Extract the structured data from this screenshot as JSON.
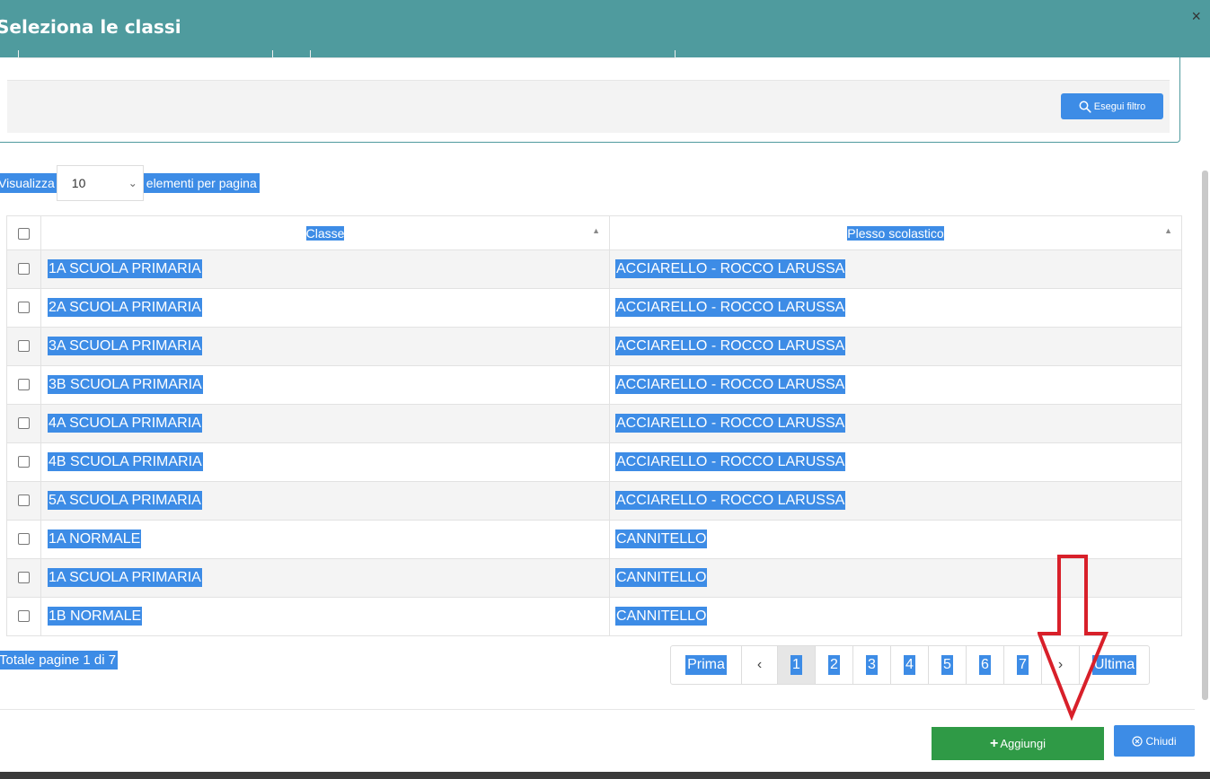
{
  "dialog": {
    "title": "Seleziona le classi",
    "close_glyph": "×"
  },
  "filter": {
    "button_label": "Esegui filtro",
    "button_icon": "search-icon"
  },
  "page_size": {
    "label_before": "Visualizza",
    "value": "10",
    "label_after": "elementi per pagina"
  },
  "table": {
    "headers": {
      "classe": "Classe",
      "plesso": "Plesso scolastico"
    },
    "rows": [
      {
        "classe": "1A SCUOLA PRIMARIA",
        "plesso": "ACCIARELLO - ROCCO LARUSSA"
      },
      {
        "classe": "2A SCUOLA PRIMARIA",
        "plesso": "ACCIARELLO - ROCCO LARUSSA"
      },
      {
        "classe": "3A SCUOLA PRIMARIA",
        "plesso": "ACCIARELLO - ROCCO LARUSSA"
      },
      {
        "classe": "3B SCUOLA PRIMARIA",
        "plesso": "ACCIARELLO - ROCCO LARUSSA"
      },
      {
        "classe": "4A SCUOLA PRIMARIA",
        "plesso": "ACCIARELLO - ROCCO LARUSSA"
      },
      {
        "classe": "4B SCUOLA PRIMARIA",
        "plesso": "ACCIARELLO - ROCCO LARUSSA"
      },
      {
        "classe": "5A SCUOLA PRIMARIA",
        "plesso": "ACCIARELLO - ROCCO LARUSSA"
      },
      {
        "classe": "1A NORMALE",
        "plesso": "CANNITELLO"
      },
      {
        "classe": "1A SCUOLA PRIMARIA",
        "plesso": "CANNITELLO"
      },
      {
        "classe": "1B NORMALE",
        "plesso": "CANNITELLO"
      }
    ]
  },
  "pagination": {
    "total_text": "Totale pagine 1 di 7",
    "first": "Prima",
    "prev": "‹",
    "pages": [
      "1",
      "2",
      "3",
      "4",
      "5",
      "6",
      "7"
    ],
    "current_page": "1",
    "next": "›",
    "last": "Ultima"
  },
  "actions": {
    "add_label": "Aggiungi",
    "close_label": "Chiudi"
  },
  "colors": {
    "header": "#4f9b9e",
    "selection": "#3d8ce6",
    "add_button": "#2f9a46",
    "annotation_arrow": "#d8202a"
  }
}
